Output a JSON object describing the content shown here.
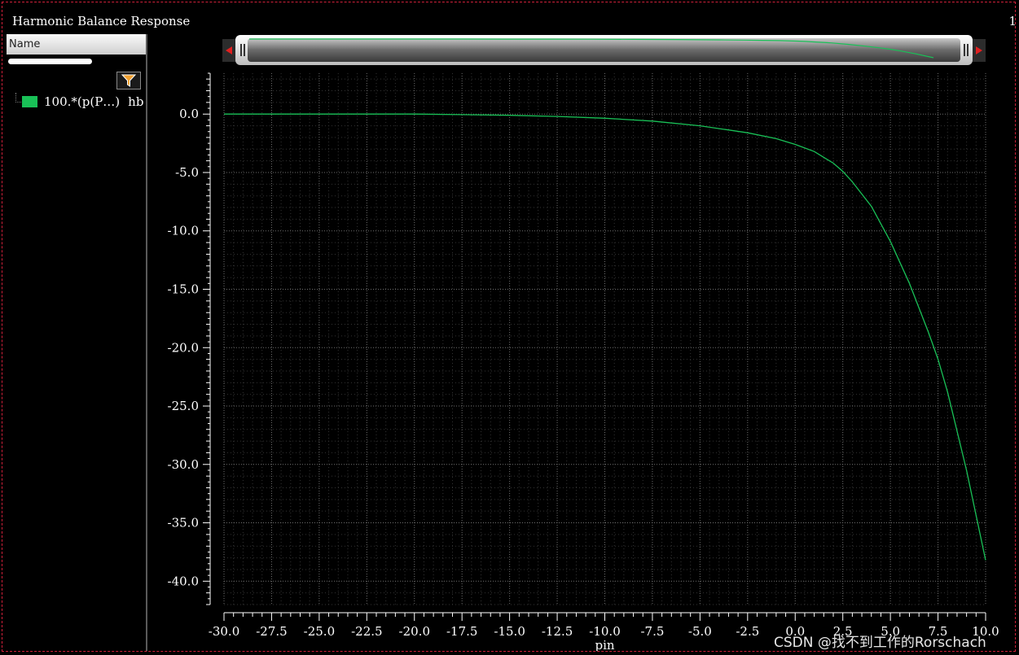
{
  "window": {
    "title": "Harmonic Balance Response",
    "corner_label": "1"
  },
  "panel": {
    "header": "Name",
    "legend": [
      {
        "label": "100.*(p(P…)",
        "suffix": "hb",
        "color": "#19c157"
      }
    ],
    "filter_icon": "funnel-icon"
  },
  "watermark": "CSDN @找不到工作的Rorschach",
  "colors": {
    "trace": "#19c157",
    "background": "#000000",
    "grid": "#6e6e6e",
    "frame": "#d0203a"
  },
  "chart_data": {
    "type": "line",
    "xlabel": "pin",
    "ylabel": "",
    "xlim": [
      -30,
      10
    ],
    "ylim": [
      -42,
      3.5
    ],
    "xticks": [
      -30,
      -27.5,
      -25,
      -22.5,
      -20,
      -17.5,
      -15,
      -12.5,
      -10,
      -7.5,
      -5,
      -2.5,
      0,
      2.5,
      5,
      7.5,
      10
    ],
    "yticks": [
      0,
      -5,
      -10,
      -15,
      -20,
      -25,
      -30,
      -35,
      -40
    ],
    "tick_format": 1,
    "grid": true,
    "series": [
      {
        "color": "#19c157",
        "x": [
          -30,
          -27.5,
          -25,
          -22.5,
          -20,
          -17.5,
          -15,
          -12.5,
          -10,
          -7.5,
          -5,
          -2.5,
          -1,
          0,
          1,
          2,
          2.5,
          3,
          4,
          5,
          6,
          7,
          7.5,
          8,
          9,
          10
        ],
        "y": [
          0.0,
          0.0,
          0.0,
          0.0,
          0.0,
          -0.05,
          -0.1,
          -0.2,
          -0.35,
          -0.6,
          -1.0,
          -1.6,
          -2.1,
          -2.6,
          -3.2,
          -4.2,
          -4.9,
          -5.8,
          -7.9,
          -10.9,
          -14.5,
          -18.7,
          -21.0,
          -23.8,
          -30.5,
          -38.2
        ]
      }
    ]
  }
}
